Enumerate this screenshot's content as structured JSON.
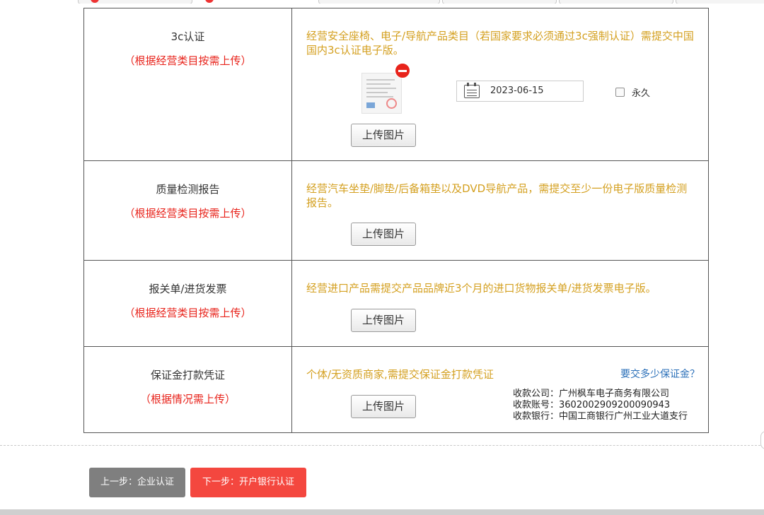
{
  "rows": [
    {
      "name": "3c认证",
      "note": "（根据经营类目按需上传）",
      "desc": "经营安全座椅、电子/导航产品类目（若国家要求必须通过3c强制认证）需提交中国国内3c认证电子版。",
      "upload_label": "上传图片",
      "date_value": "2023-06-15",
      "permanent_label": "永久"
    },
    {
      "name": "质量检测报告",
      "note": "（根据经营类目按需上传）",
      "desc": "经营汽车坐垫/脚垫/后备箱垫以及DVD导航产品，需提交至少一份电子版质量检测报告。",
      "upload_label": "上传图片"
    },
    {
      "name": "报关单/进货发票",
      "note": "（根据经营类目按需上传）",
      "desc": "经营进口产品需提交产品品牌近3个月的进口货物报关单/进货发票电子版。",
      "upload_label": "上传图片"
    },
    {
      "name": "保证金打款凭证",
      "note": "（根据情况需上传）",
      "desc": "个体/无资质商家,需提交保证金打款凭证",
      "upload_label": "上传图片",
      "deposit_link": "要交多少保证金？",
      "payee_company": "收款公司：广州枫车电子商务有限公司",
      "payee_account": "收款账号：3602002909200090943",
      "payee_bank": "收款银行：中国工商银行广州工业大道支行"
    }
  ],
  "nav": {
    "prev_label": "上一步：企业认证",
    "next_label": "下一步：开户银行认证"
  },
  "colors": {
    "accent_red": "#e8231b",
    "desc_gold": "#d4a020",
    "link_blue": "#2a6fb8",
    "prev_button": "#7f7f7f",
    "next_button": "#f4473f"
  },
  "icons": [
    "calendar-icon",
    "remove-icon"
  ]
}
